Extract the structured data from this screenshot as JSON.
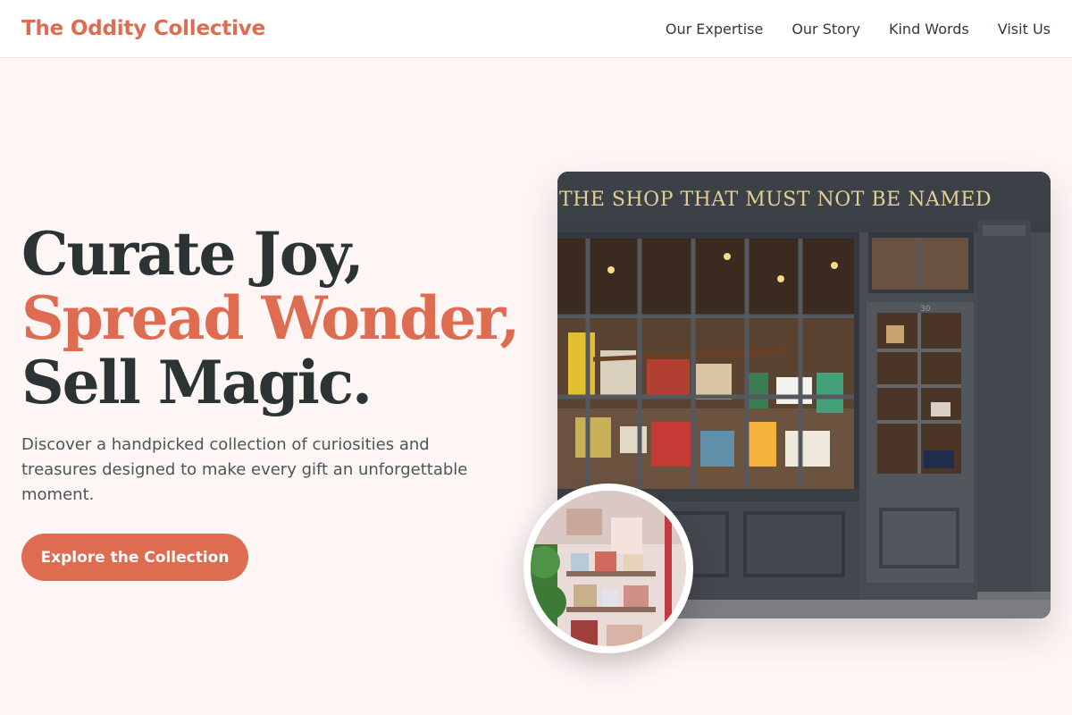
{
  "header": {
    "brand": "The Oddity Collective",
    "nav": [
      {
        "label": "Our Expertise"
      },
      {
        "label": "Our Story"
      },
      {
        "label": "Kind Words"
      },
      {
        "label": "Visit Us"
      }
    ]
  },
  "hero": {
    "headline": {
      "line1": "Curate Joy,",
      "line2": "Spread Wonder,",
      "line3": "Sell Magic."
    },
    "subtitle": "Discover a handpicked collection of curiosities and treasures designed to make every gift an unforgettable moment.",
    "cta_label": "Explore the Collection"
  },
  "images": {
    "storefront_sign": "THE SHOP THAT MUST NOT BE NAMED",
    "door_number": "30"
  },
  "colors": {
    "accent": "#dd6c51",
    "heading": "#2b3335",
    "background": "#fdf6f5",
    "shopfront": "#474b52"
  }
}
